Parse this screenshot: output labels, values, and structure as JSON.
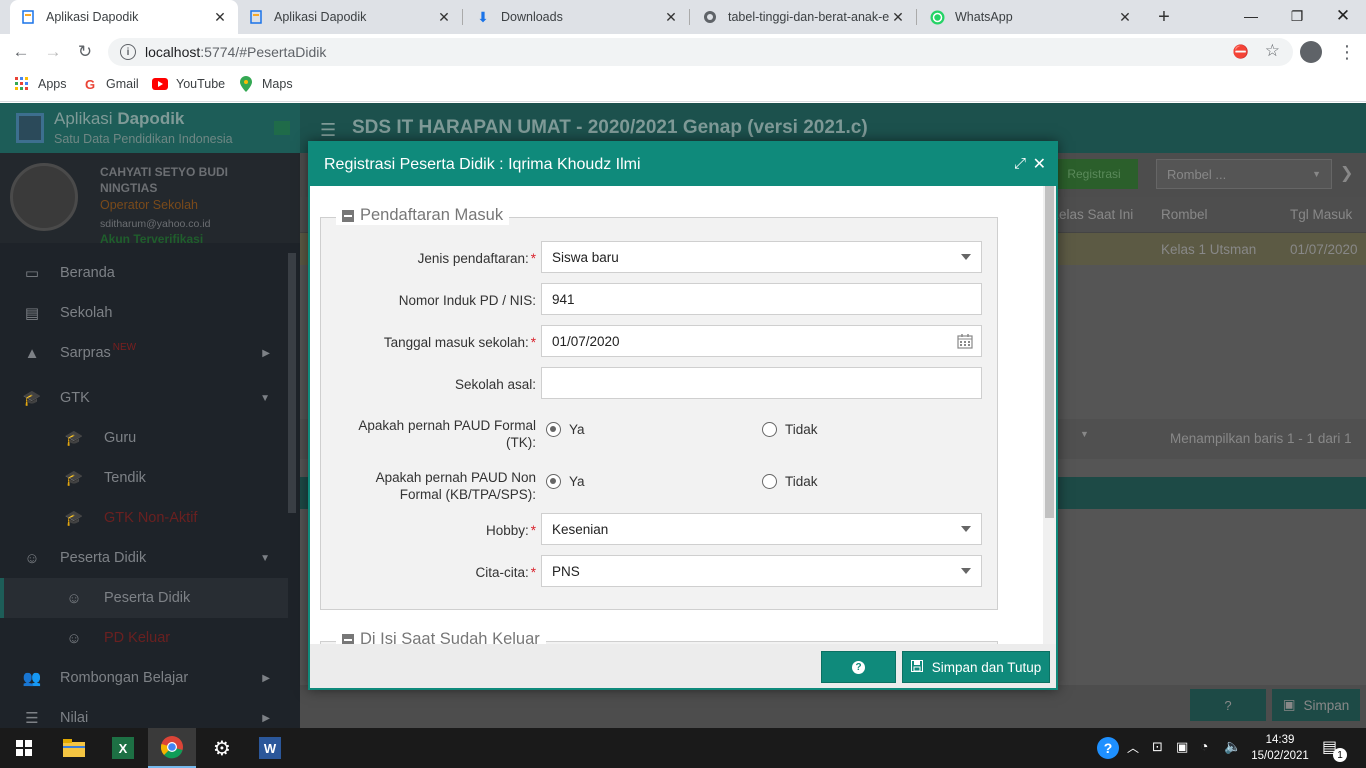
{
  "browser": {
    "tabs": [
      {
        "title": "Aplikasi Dapodik"
      },
      {
        "title": "Aplikasi Dapodik"
      },
      {
        "title": "Downloads"
      },
      {
        "title": "tabel-tinggi-dan-berat-anak-e"
      },
      {
        "title": "WhatsApp"
      }
    ],
    "url_host": "localhost",
    "url_rest": ":5774/#PesertaDidik",
    "bookmarks": [
      "Apps",
      "Gmail",
      "YouTube",
      "Maps"
    ]
  },
  "app": {
    "brand_title_a": "Aplikasi ",
    "brand_title_b": "Dapodik",
    "brand_subtitle": "Satu Data Pendidikan Indonesia",
    "header_title": "SDS IT HARAPAN UMAT - 2020/2021 Genap (versi 2021.c)",
    "user": {
      "name": "CAHYATI SETYO BUDI NINGTIAS",
      "role": "Operator Sekolah",
      "email": "sditharum@yahoo.co.id",
      "status": "Akun Terverifikasi"
    },
    "menu": [
      {
        "label": "Beranda"
      },
      {
        "label": "Sekolah"
      },
      {
        "label": "Sarpras",
        "badge": "NEW"
      },
      {
        "label": "GTK"
      },
      {
        "label": "Guru"
      },
      {
        "label": "Tendik"
      },
      {
        "label": "GTK Non-Aktif"
      },
      {
        "label": "Peserta Didik"
      },
      {
        "label": "Peserta Didik"
      },
      {
        "label": "PD Keluar"
      },
      {
        "label": "Rombongan Belajar"
      },
      {
        "label": "Nilai"
      }
    ],
    "toolbar": {
      "registrasi": "Registrasi",
      "rombel_placeholder": "Rombel ..."
    },
    "table": {
      "headers": [
        "Kelas Saat Ini",
        "Rombel",
        "Tgl Masuk"
      ],
      "row": [
        "Kelas 1 Utsman",
        "01/07/2020"
      ]
    },
    "paging_text": "Menampilkan baris 1 - 1 dari 1",
    "bottom_save": "Simpan"
  },
  "modal": {
    "title": "Registrasi Peserta Didik : Iqrima Khoudz Ilmi",
    "section1": "Pendaftaran Masuk",
    "section2": "Di Isi Saat Sudah Keluar",
    "fields": {
      "jenis_label": "Jenis pendaftaran:",
      "jenis_value": "Siswa baru",
      "nis_label": "Nomor Induk PD / NIS:",
      "nis_value": "941",
      "tgl_label": "Tanggal masuk sekolah:",
      "tgl_value": "01/07/2020",
      "asal_label": "Sekolah asal:",
      "asal_value": "",
      "paud_formal_label": "Apakah pernah PAUD Formal (TK):",
      "paud_nonformal_label": "Apakah pernah PAUD Non Formal (KB/TPA/SPS):",
      "ya": "Ya",
      "tidak": "Tidak",
      "hobby_label": "Hobby:",
      "hobby_value": "Kesenian",
      "cita_label": "Cita-cita:",
      "cita_value": "PNS"
    },
    "save_button": "Simpan dan Tutup"
  },
  "taskbar": {
    "time": "14:39",
    "date": "15/02/2021",
    "notif_count": "1"
  },
  "colors": {
    "accent": "#0f8a7b",
    "required": "#d9232d"
  },
  "icons": [
    "doc-favicon",
    "download-icon",
    "globe-icon",
    "whatsapp-icon",
    "calendar-icon",
    "help-icon",
    "save-icon",
    "expand-icon",
    "close-icon"
  ]
}
